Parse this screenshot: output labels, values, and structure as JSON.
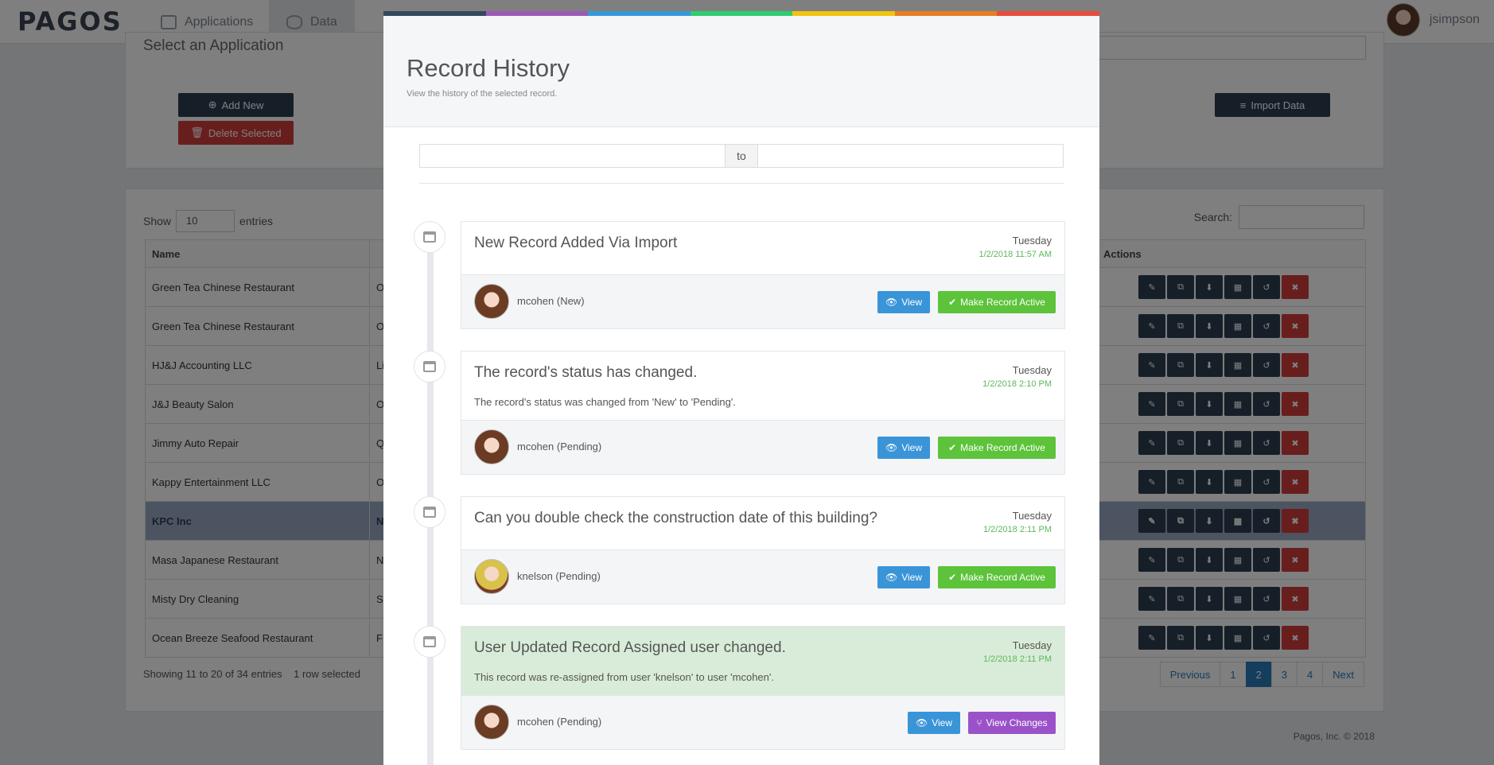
{
  "nav": {
    "logo": "PAGOS",
    "tabs": [
      {
        "label": "Applications"
      },
      {
        "label": "Data"
      }
    ],
    "user": "jsimpson"
  },
  "app_panel": {
    "title": "Select an Application",
    "add_new": "Add New",
    "delete_selected": "Delete Selected",
    "import_data": "Import Data"
  },
  "table": {
    "show_label": "Show",
    "page_size": "10",
    "entries_label": "entries",
    "search_label": "Search:",
    "col_name": "Name",
    "col_actions": "Actions",
    "rows": [
      {
        "name": "Green Tea Chinese Restaurant",
        "c2": "O"
      },
      {
        "name": "Green Tea Chinese Restaurant",
        "c2": "O"
      },
      {
        "name": "HJ&J Accounting LLC",
        "c2": "Li"
      },
      {
        "name": "J&J Beauty Salon",
        "c2": "O"
      },
      {
        "name": "Jimmy Auto Repair",
        "c2": "Q"
      },
      {
        "name": "Kappy Entertainment LLC",
        "c2": "O"
      },
      {
        "name": "KPC Inc",
        "c2": "N"
      },
      {
        "name": "Masa Japanese Restaurant",
        "c2": "N"
      },
      {
        "name": "Misty Dry Cleaning",
        "c2": "S"
      },
      {
        "name": "Ocean Breeze Seafood Restaurant",
        "c2": "F"
      }
    ],
    "showing": "Showing 11 to 20 of 34 entries",
    "selected": "1 row selected",
    "pager": [
      "Previous",
      "1",
      "2",
      "3",
      "4",
      "Next"
    ],
    "current_page": "2"
  },
  "footer": {
    "copyright": "Pagos, Inc. © 2018"
  },
  "modal": {
    "title": "Record History",
    "subtitle": "View the history of the selected record.",
    "to_label": "to",
    "rainbow": [
      "#34495e",
      "#9b59b6",
      "#3498db",
      "#2ecc71",
      "#f1c40f",
      "#e67e22",
      "#e74c3c"
    ],
    "entries": [
      {
        "title": "New Record Added Via Import",
        "desc": "",
        "day": "Tuesday",
        "date": "1/2/2018 11:57 AM",
        "user": "mcohen (New)",
        "view": "View",
        "action": "Make Record Active"
      },
      {
        "title": "The record's status has changed.",
        "desc": "The record's status was changed from 'New' to 'Pending'.",
        "day": "Tuesday",
        "date": "1/2/2018 2:10 PM",
        "user": "mcohen (Pending)",
        "view": "View",
        "action": "Make Record Active"
      },
      {
        "title": "Can you double check the construction date of this building?",
        "desc": "",
        "day": "Tuesday",
        "date": "1/2/2018 2:11 PM",
        "user": "knelson (Pending)",
        "view": "View",
        "action": "Make Record Active"
      },
      {
        "title": "User Updated Record Assigned user changed.",
        "desc": "This record was re-assigned from user 'knelson' to user 'mcohen'.",
        "day": "Tuesday",
        "date": "1/2/2018 2:11 PM",
        "user": "mcohen (Pending)",
        "view": "View",
        "action": "View Changes"
      }
    ]
  }
}
